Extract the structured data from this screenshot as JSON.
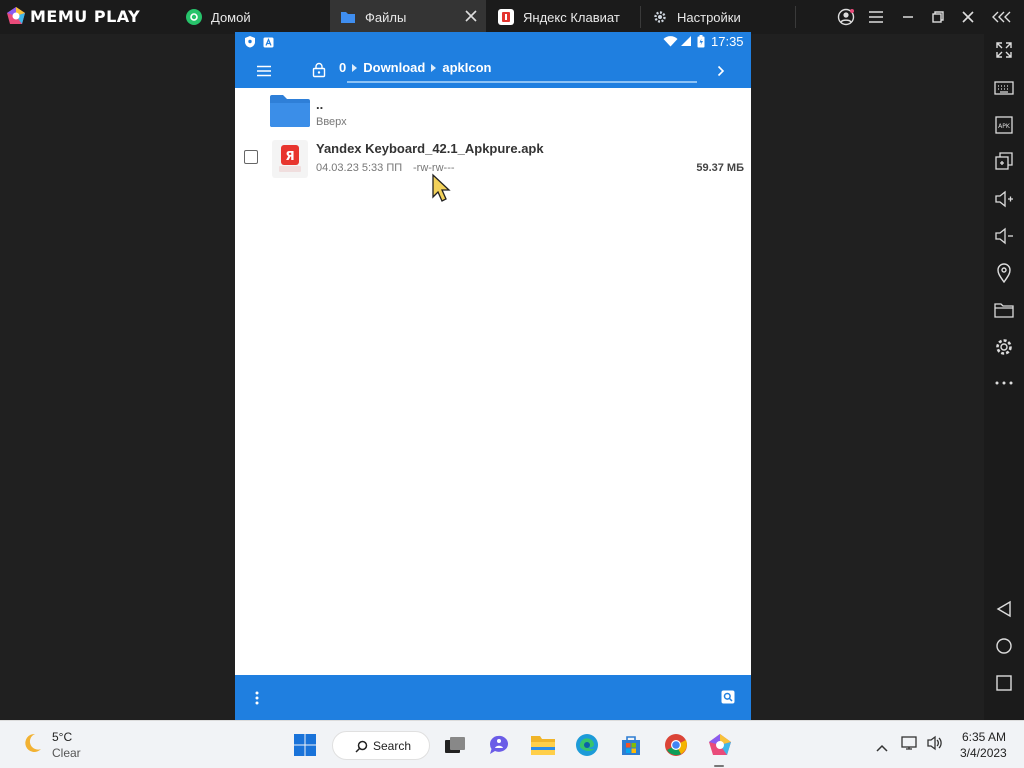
{
  "app": {
    "name": "MEMU PLAY",
    "tabs": [
      {
        "label": "Домой",
        "icon": "home-app-icon"
      },
      {
        "label": "Файлы",
        "icon": "folder-icon",
        "active": true
      },
      {
        "label": "Яндекс Клавиат",
        "icon": "yandex-icon"
      },
      {
        "label": "Настройки",
        "icon": "gear-icon"
      }
    ],
    "accent": "#1f7fe0"
  },
  "android": {
    "status": {
      "time": "17:35"
    },
    "breadcrumb": [
      {
        "label": "0"
      },
      {
        "label": "Download"
      },
      {
        "label": "apkIcon"
      }
    ],
    "files": [
      {
        "name": "..",
        "subtitle": "Вверх",
        "type": "folder"
      },
      {
        "name": "Yandex Keyboard_42.1_Apkpure.apk",
        "date": "04.03.23 5:33 ПП",
        "perms": "-rw-rw---",
        "size": "59.37 МБ",
        "type": "apk"
      }
    ]
  },
  "taskbar": {
    "weather": {
      "temp": "5°C",
      "condition": "Clear"
    },
    "search_label": "Search",
    "clock": {
      "time": "6:35 AM",
      "date": "3/4/2023"
    }
  }
}
